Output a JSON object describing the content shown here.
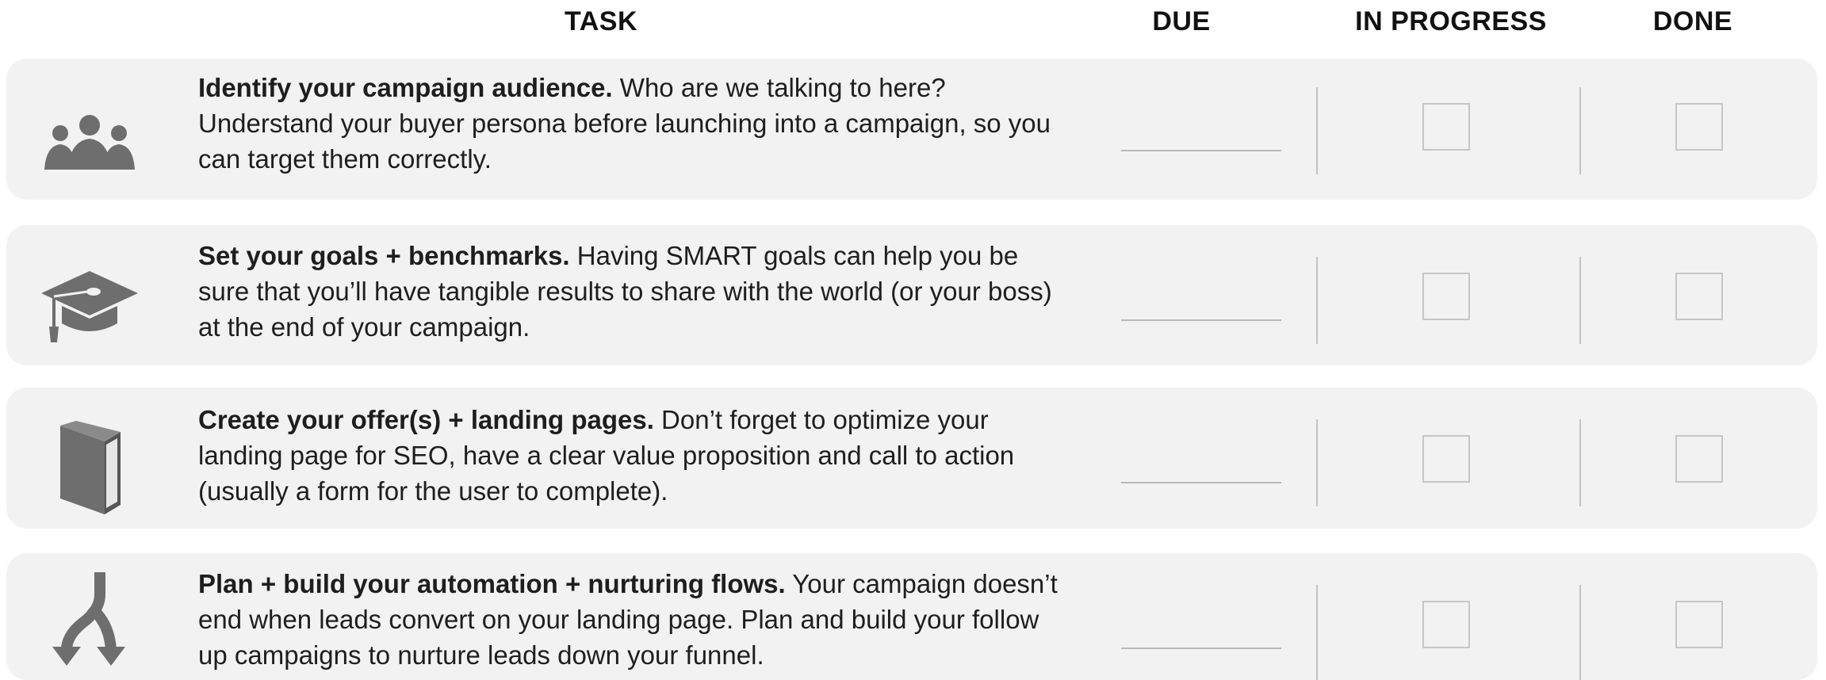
{
  "header": {
    "task": "TASK",
    "due": "DUE",
    "in_progress": "IN PROGRESS",
    "done": "DONE"
  },
  "colors": {
    "row_background": "#f2f2f2",
    "icon": "#6e6e6e",
    "text": "#1e1e1e"
  },
  "tasks": [
    {
      "icon": "people-icon",
      "title": "Identify your campaign audience.",
      "text": " Who are we talking to here? Understand your buyer persona before launching into a campaign, so you can target them correctly."
    },
    {
      "icon": "graduation-cap-icon",
      "title": "Set your goals + benchmarks.",
      "text": " Having SMART goals can help you be sure that you’ll have tangible results to share with the world (or your boss) at the end of your campaign."
    },
    {
      "icon": "book-icon",
      "title": "Create your offer(s) + landing pages.",
      "text": " Don’t forget to optimize your landing page for SEO, have a clear value proposition and call to action (usually a form for the user to complete)."
    },
    {
      "icon": "branching-arrows-icon",
      "title": "Plan + build your automation + nurturing flows.",
      "text": " Your campaign doesn’t end when leads convert on your landing page. Plan and build your follow up campaigns to nurture leads down your funnel."
    }
  ]
}
